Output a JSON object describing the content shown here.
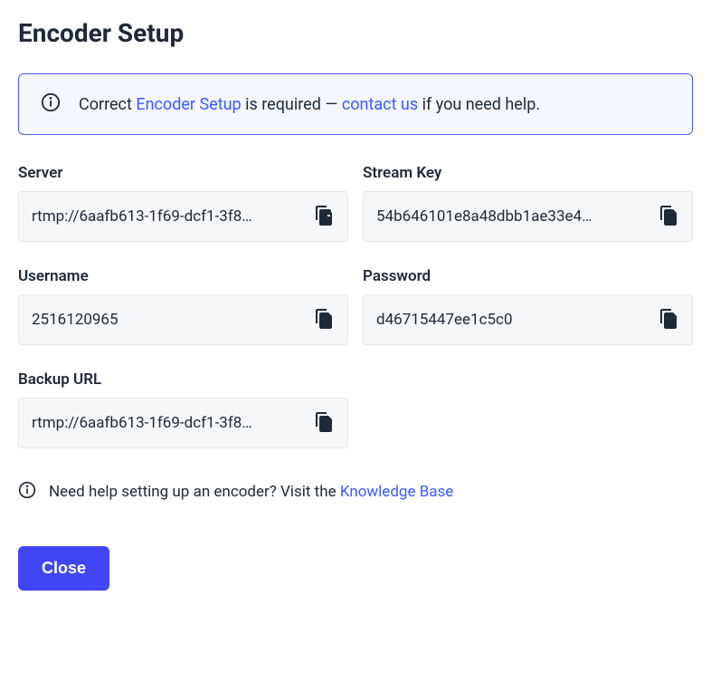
{
  "title": "Encoder Setup",
  "banner": {
    "prefix": "Correct ",
    "link1": "Encoder Setup",
    "middle": " is required — ",
    "link2": "contact us",
    "suffix": " if you need help."
  },
  "fields": {
    "server": {
      "label": "Server",
      "value": "rtmp://6aafb613-1f69-dcf1-3f8…"
    },
    "streamKey": {
      "label": "Stream Key",
      "value": "54b646101e8a48dbb1ae33e4…"
    },
    "username": {
      "label": "Username",
      "value": "2516120965"
    },
    "password": {
      "label": "Password",
      "value": "d46715447ee1c5c0"
    },
    "backupUrl": {
      "label": "Backup URL",
      "value": "rtmp://6aafb613-1f69-dcf1-3f8…"
    }
  },
  "help": {
    "prefix": "Need help setting up an encoder? Visit the ",
    "link": "Knowledge Base"
  },
  "buttons": {
    "close": "Close"
  }
}
